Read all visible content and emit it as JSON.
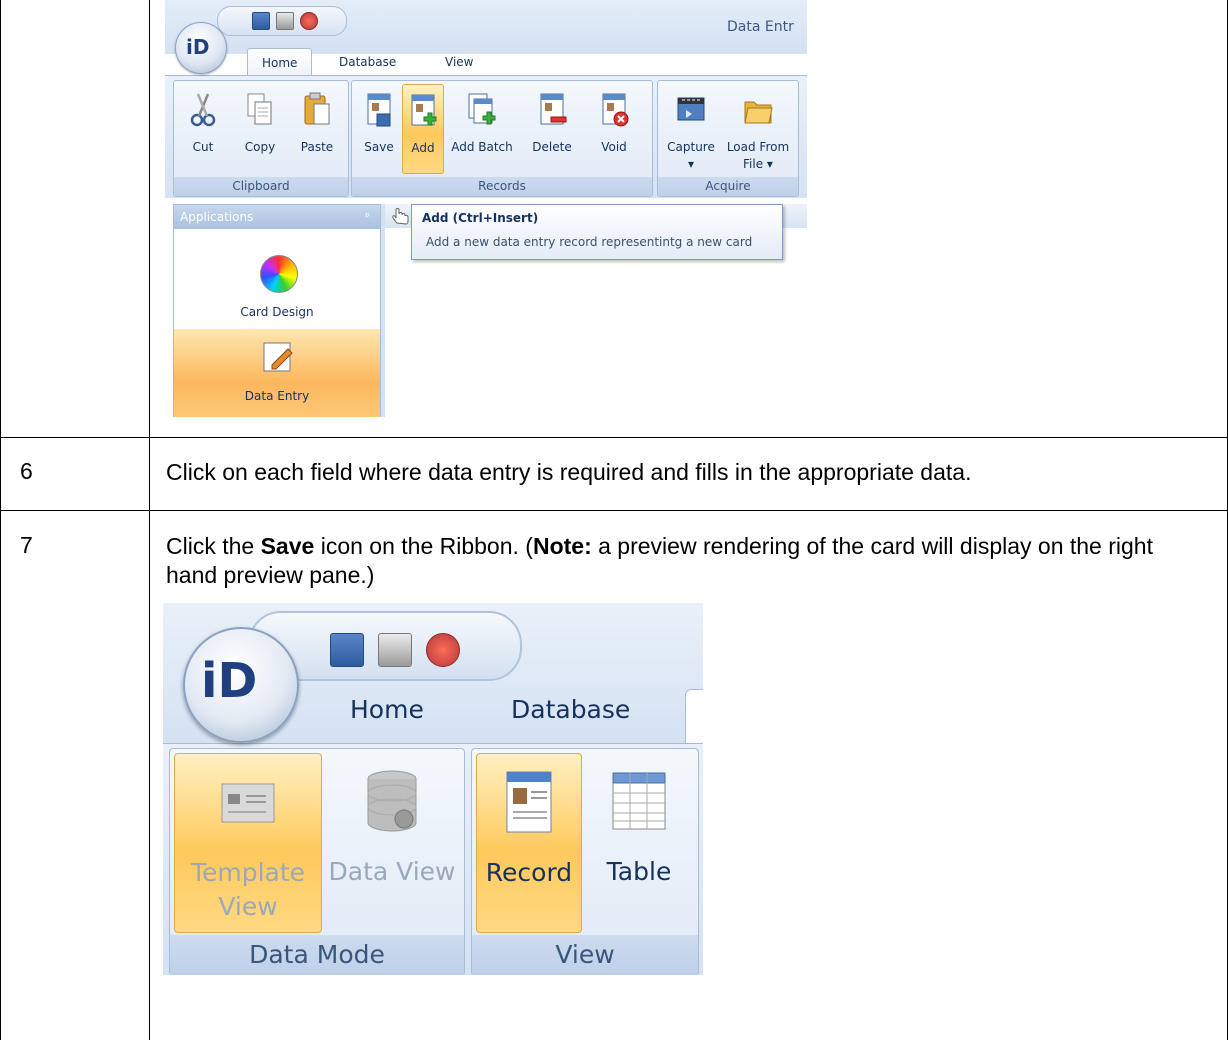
{
  "steps": [
    {
      "number": "6",
      "text": "Click on each field where data entry is required and fills in the appropriate data."
    },
    {
      "number": "7",
      "text_pre": "Click the ",
      "text_bold": "Save",
      "text_mid": " icon on the Ribbon. (",
      "note_label": "Note:",
      "text_post": "  a preview rendering of the card will display on the right hand preview pane.)"
    }
  ],
  "screenshot1": {
    "window_title": "Data Entr",
    "orb_label": "iD",
    "quick_access_icons": [
      "save-icon",
      "print-icon",
      "database-icon"
    ],
    "tabs": [
      "Home",
      "Database",
      "View"
    ],
    "active_tab": "Home",
    "groups": {
      "clipboard": {
        "label": "Clipboard",
        "buttons": [
          "Cut",
          "Copy",
          "Paste"
        ]
      },
      "records": {
        "label": "Records",
        "buttons": [
          "Save",
          "Add",
          "Add Batch",
          "Delete",
          "Void"
        ]
      },
      "acquire": {
        "label": "Acquire",
        "buttons": [
          "Capture",
          "Load From"
        ],
        "capture_sub": "▾",
        "load_sub": "File ▾"
      }
    },
    "highlighted_button": "Add",
    "tooltip": {
      "title": "Add (Ctrl+Insert)",
      "description": "Add a new data entry record representintg a new card"
    },
    "applications": {
      "header": "Applications",
      "pin": "ᵖ",
      "items": [
        "Card Design",
        "Data Entry"
      ],
      "selected": "Data Entry"
    }
  },
  "screenshot2": {
    "orb_label": "iD",
    "tabs": [
      "Home",
      "Database"
    ],
    "groups": {
      "data_mode": {
        "label": "Data Mode",
        "buttons": [
          "Template\nView",
          "Data View"
        ]
      },
      "view": {
        "label": "View",
        "buttons": [
          "Record",
          "Table"
        ]
      }
    },
    "highlighted_buttons": [
      "Template View",
      "Record"
    ]
  },
  "colors": {
    "ribbon_blue": "#d4e2f3",
    "highlight_orange": "#ffc95c",
    "text_dark_blue": "#15325d"
  }
}
